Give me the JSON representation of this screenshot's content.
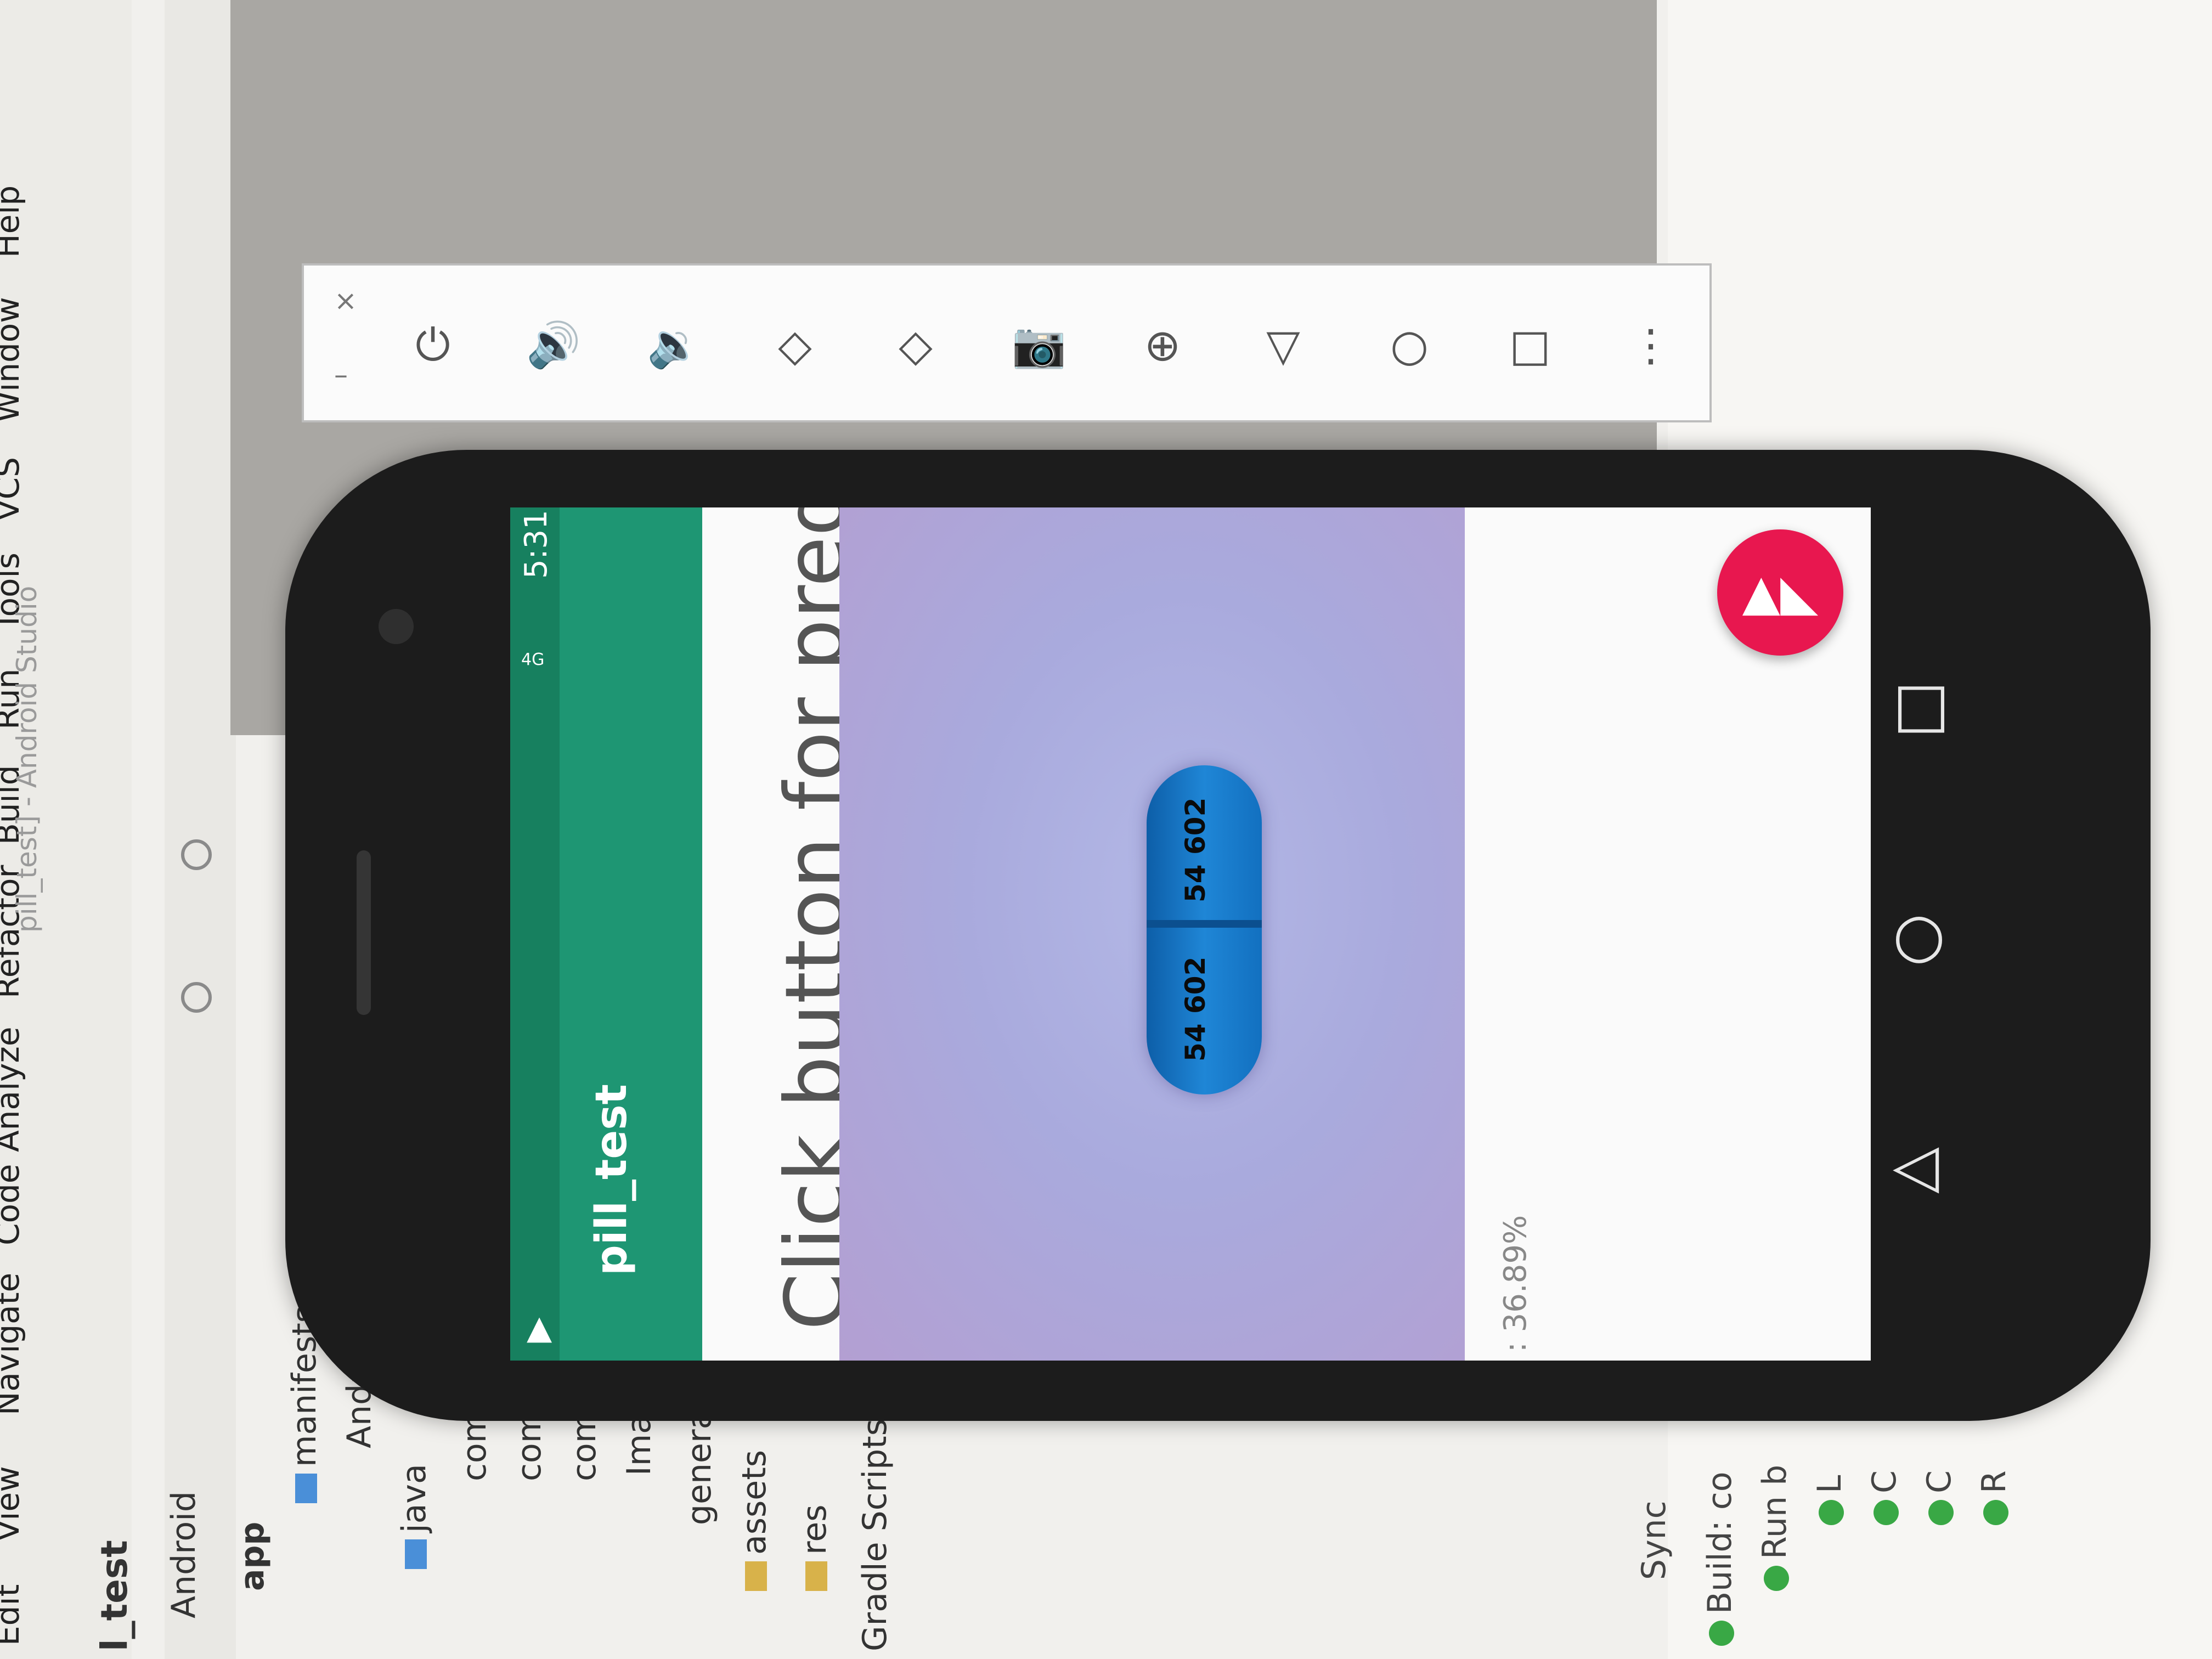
{
  "ide": {
    "title": "pill_test] - Android Studio",
    "menu": [
      "Edit",
      "View",
      "Navigate",
      "Code",
      "Analyze",
      "Refactor",
      "Build",
      "Run",
      "Tools",
      "VCS",
      "Window",
      "Help"
    ],
    "breadcrumb": "l_test",
    "project_view": "Android",
    "tree": [
      "app",
      "manifests",
      "Androi",
      "java",
      "com.e",
      "com.e",
      "com.e",
      "Image",
      "generated",
      "assets",
      "res",
      "Gradle Scripts"
    ],
    "bottom_tabs": [
      "Sync"
    ],
    "build_label": "Build: co",
    "build_rows": [
      "Run b",
      "L",
      "C",
      "C",
      "R"
    ]
  },
  "emulator": {
    "close": "×",
    "minimize": "–",
    "buttons": [
      {
        "name": "power-icon",
        "glyph": "⏻"
      },
      {
        "name": "volume-up-icon",
        "glyph": "🔊"
      },
      {
        "name": "volume-down-icon",
        "glyph": "🔉"
      },
      {
        "name": "rotate-left-icon",
        "glyph": "◇"
      },
      {
        "name": "rotate-right-icon",
        "glyph": "◇"
      },
      {
        "name": "camera-icon",
        "glyph": "📷"
      },
      {
        "name": "zoom-icon",
        "glyph": "⊕"
      },
      {
        "name": "back-icon",
        "glyph": "▽"
      },
      {
        "name": "home-icon",
        "glyph": "○"
      },
      {
        "name": "overview-icon",
        "glyph": "□"
      },
      {
        "name": "more-icon",
        "glyph": "⋮"
      }
    ]
  },
  "app": {
    "status_time": "5:31",
    "status_signal": "4G",
    "title": "pill_test",
    "prompt": "Click button for prediction",
    "pill_imprint_1": "54 602",
    "pill_imprint_2": "54 602",
    "result_text": ": 36.89%",
    "fab_icon": "image-icon",
    "colors": {
      "status_bar": "#17805f",
      "app_bar": "#1e9673",
      "fab": "#e8174f"
    }
  },
  "phone_nav": {
    "back": "◁",
    "home": "○",
    "recents": "□"
  }
}
